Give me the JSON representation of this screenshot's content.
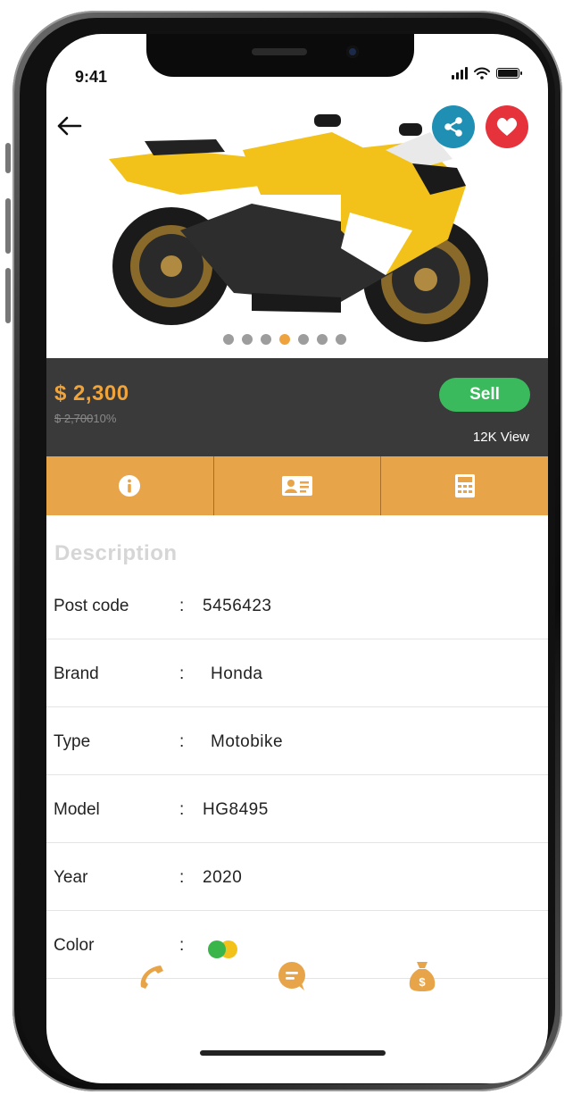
{
  "status_bar": {
    "time": "9:41"
  },
  "header": {
    "back_icon": "arrow-left-icon",
    "share_icon": "share-icon",
    "favorite_icon": "heart-icon",
    "share_color": "#1f8fb3",
    "favorite_color": "#e5323b"
  },
  "gallery": {
    "image": "yellow-sport-motorcycle",
    "total_images": 7,
    "active_index": 3
  },
  "pricing": {
    "price": "$ 2,300",
    "old_price": "$ 2,700",
    "discount": "10%",
    "sell_label": "Sell",
    "views": "12K View"
  },
  "tabs": [
    {
      "icon": "info-icon"
    },
    {
      "icon": "id-card-icon"
    },
    {
      "icon": "calculator-icon"
    }
  ],
  "description": {
    "title": "Description",
    "rows": [
      {
        "label": "Post code",
        "sep": ":",
        "value": "5456423"
      },
      {
        "label": "Brand",
        "sep": ":",
        "value": "Honda"
      },
      {
        "label": "Type",
        "sep": ":",
        "value": "Motobike"
      },
      {
        "label": "Model",
        "sep": ":",
        "value": "HG8495"
      },
      {
        "label": "Year",
        "sep": ":",
        "value": "2020"
      },
      {
        "label": "Color",
        "sep": ":",
        "colors": [
          "#3ab54a",
          "#f2c21b"
        ]
      }
    ]
  },
  "bottom_actions": [
    {
      "icon": "phone-icon"
    },
    {
      "icon": "chat-icon"
    },
    {
      "icon": "money-bag-icon"
    }
  ],
  "theme": {
    "accent": "#e8a448",
    "dark_bar": "#3a3a3a",
    "sell_green": "#3aba5c"
  }
}
